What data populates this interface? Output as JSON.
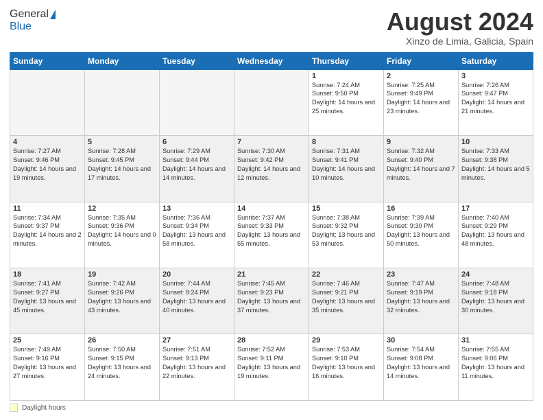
{
  "header": {
    "logo_general": "General",
    "logo_blue": "Blue",
    "month_title": "August 2024",
    "location": "Xinzo de Limia, Galicia, Spain"
  },
  "weekdays": [
    "Sunday",
    "Monday",
    "Tuesday",
    "Wednesday",
    "Thursday",
    "Friday",
    "Saturday"
  ],
  "weeks": [
    [
      {
        "day": "",
        "info": "",
        "empty": true
      },
      {
        "day": "",
        "info": "",
        "empty": true
      },
      {
        "day": "",
        "info": "",
        "empty": true
      },
      {
        "day": "",
        "info": "",
        "empty": true
      },
      {
        "day": "1",
        "info": "Sunrise: 7:24 AM\nSunset: 9:50 PM\nDaylight: 14 hours and 25 minutes.",
        "empty": false
      },
      {
        "day": "2",
        "info": "Sunrise: 7:25 AM\nSunset: 9:49 PM\nDaylight: 14 hours and 23 minutes.",
        "empty": false
      },
      {
        "day": "3",
        "info": "Sunrise: 7:26 AM\nSunset: 9:47 PM\nDaylight: 14 hours and 21 minutes.",
        "empty": false
      }
    ],
    [
      {
        "day": "4",
        "info": "Sunrise: 7:27 AM\nSunset: 9:46 PM\nDaylight: 14 hours and 19 minutes.",
        "empty": false
      },
      {
        "day": "5",
        "info": "Sunrise: 7:28 AM\nSunset: 9:45 PM\nDaylight: 14 hours and 17 minutes.",
        "empty": false
      },
      {
        "day": "6",
        "info": "Sunrise: 7:29 AM\nSunset: 9:44 PM\nDaylight: 14 hours and 14 minutes.",
        "empty": false
      },
      {
        "day": "7",
        "info": "Sunrise: 7:30 AM\nSunset: 9:42 PM\nDaylight: 14 hours and 12 minutes.",
        "empty": false
      },
      {
        "day": "8",
        "info": "Sunrise: 7:31 AM\nSunset: 9:41 PM\nDaylight: 14 hours and 10 minutes.",
        "empty": false
      },
      {
        "day": "9",
        "info": "Sunrise: 7:32 AM\nSunset: 9:40 PM\nDaylight: 14 hours and 7 minutes.",
        "empty": false
      },
      {
        "day": "10",
        "info": "Sunrise: 7:33 AM\nSunset: 9:38 PM\nDaylight: 14 hours and 5 minutes.",
        "empty": false
      }
    ],
    [
      {
        "day": "11",
        "info": "Sunrise: 7:34 AM\nSunset: 9:37 PM\nDaylight: 14 hours and 2 minutes.",
        "empty": false
      },
      {
        "day": "12",
        "info": "Sunrise: 7:35 AM\nSunset: 9:36 PM\nDaylight: 14 hours and 0 minutes.",
        "empty": false
      },
      {
        "day": "13",
        "info": "Sunrise: 7:36 AM\nSunset: 9:34 PM\nDaylight: 13 hours and 58 minutes.",
        "empty": false
      },
      {
        "day": "14",
        "info": "Sunrise: 7:37 AM\nSunset: 9:33 PM\nDaylight: 13 hours and 55 minutes.",
        "empty": false
      },
      {
        "day": "15",
        "info": "Sunrise: 7:38 AM\nSunset: 9:32 PM\nDaylight: 13 hours and 53 minutes.",
        "empty": false
      },
      {
        "day": "16",
        "info": "Sunrise: 7:39 AM\nSunset: 9:30 PM\nDaylight: 13 hours and 50 minutes.",
        "empty": false
      },
      {
        "day": "17",
        "info": "Sunrise: 7:40 AM\nSunset: 9:29 PM\nDaylight: 13 hours and 48 minutes.",
        "empty": false
      }
    ],
    [
      {
        "day": "18",
        "info": "Sunrise: 7:41 AM\nSunset: 9:27 PM\nDaylight: 13 hours and 45 minutes.",
        "empty": false
      },
      {
        "day": "19",
        "info": "Sunrise: 7:42 AM\nSunset: 9:26 PM\nDaylight: 13 hours and 43 minutes.",
        "empty": false
      },
      {
        "day": "20",
        "info": "Sunrise: 7:44 AM\nSunset: 9:24 PM\nDaylight: 13 hours and 40 minutes.",
        "empty": false
      },
      {
        "day": "21",
        "info": "Sunrise: 7:45 AM\nSunset: 9:23 PM\nDaylight: 13 hours and 37 minutes.",
        "empty": false
      },
      {
        "day": "22",
        "info": "Sunrise: 7:46 AM\nSunset: 9:21 PM\nDaylight: 13 hours and 35 minutes.",
        "empty": false
      },
      {
        "day": "23",
        "info": "Sunrise: 7:47 AM\nSunset: 9:19 PM\nDaylight: 13 hours and 32 minutes.",
        "empty": false
      },
      {
        "day": "24",
        "info": "Sunrise: 7:48 AM\nSunset: 9:18 PM\nDaylight: 13 hours and 30 minutes.",
        "empty": false
      }
    ],
    [
      {
        "day": "25",
        "info": "Sunrise: 7:49 AM\nSunset: 9:16 PM\nDaylight: 13 hours and 27 minutes.",
        "empty": false
      },
      {
        "day": "26",
        "info": "Sunrise: 7:50 AM\nSunset: 9:15 PM\nDaylight: 13 hours and 24 minutes.",
        "empty": false
      },
      {
        "day": "27",
        "info": "Sunrise: 7:51 AM\nSunset: 9:13 PM\nDaylight: 13 hours and 22 minutes.",
        "empty": false
      },
      {
        "day": "28",
        "info": "Sunrise: 7:52 AM\nSunset: 9:11 PM\nDaylight: 13 hours and 19 minutes.",
        "empty": false
      },
      {
        "day": "29",
        "info": "Sunrise: 7:53 AM\nSunset: 9:10 PM\nDaylight: 13 hours and 16 minutes.",
        "empty": false
      },
      {
        "day": "30",
        "info": "Sunrise: 7:54 AM\nSunset: 9:08 PM\nDaylight: 13 hours and 14 minutes.",
        "empty": false
      },
      {
        "day": "31",
        "info": "Sunrise: 7:55 AM\nSunset: 9:06 PM\nDaylight: 13 hours and 11 minutes.",
        "empty": false
      }
    ]
  ],
  "footer": {
    "daylight_label": "Daylight hours"
  }
}
